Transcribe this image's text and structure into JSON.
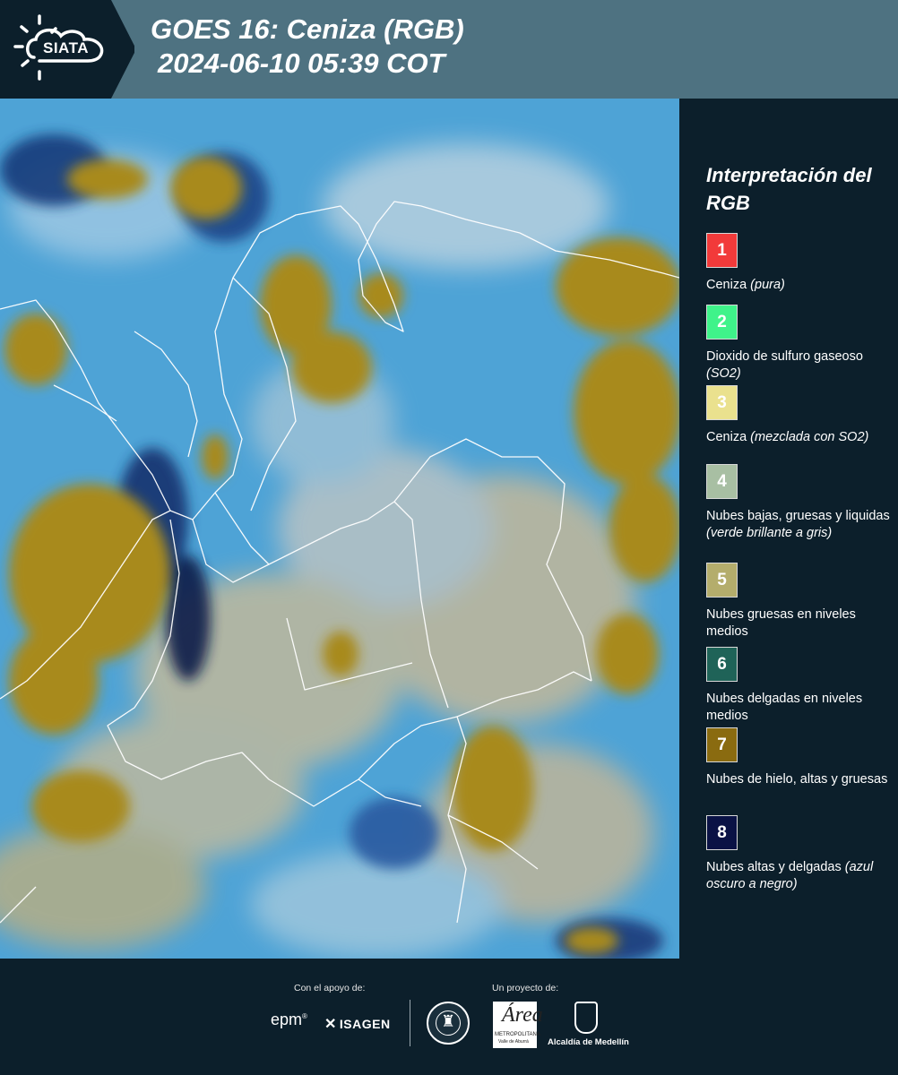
{
  "header": {
    "logo_text": "SIATA",
    "title_line1": "GOES 16: Ceniza (RGB)",
    "title_line2": "2024-06-10 05:39 COT"
  },
  "legend": {
    "title": "Interpretación del RGB",
    "items": [
      {
        "number": "1",
        "color": "#f23a3a",
        "text_color": "#ffffff",
        "label": "Ceniza",
        "note": "(pura)"
      },
      {
        "number": "2",
        "color": "#3ff38a",
        "text_color": "#ffffff",
        "label": "Dioxido de sulfuro gaseoso",
        "note": "(SO2)"
      },
      {
        "number": "3",
        "color": "#eae18e",
        "text_color": "#ffffff",
        "label": "Ceniza",
        "note": "(mezclada con SO2)"
      },
      {
        "number": "4",
        "color": "#a8bfa3",
        "text_color": "#ffffff",
        "label": "Nubes bajas, gruesas y liquidas",
        "note": "(verde brillante a gris)"
      },
      {
        "number": "5",
        "color": "#b4ad6c",
        "text_color": "#ffffff",
        "label": "Nubes gruesas en niveles medios",
        "note": ""
      },
      {
        "number": "6",
        "color": "#1f6358",
        "text_color": "#ffffff",
        "label": "Nubes delgadas en niveles medios",
        "note": ""
      },
      {
        "number": "7",
        "color": "#8a6b10",
        "text_color": "#ffffff",
        "label": "Nubes de hielo, altas y gruesas",
        "note": ""
      },
      {
        "number": "8",
        "color": "#0a1245",
        "text_color": "#ffffff",
        "label": "Nubes altas y delgadas",
        "note": "(azul oscuro a negro)"
      }
    ]
  },
  "footer": {
    "support_label": "Con el apoyo de:",
    "project_label": "Un proyecto de:",
    "sponsor1": "epm",
    "sponsor2": "ISAGEN",
    "partner_area_big": "Área",
    "partner_area_small1": "METROPOLITANA",
    "partner_area_small2": "Valle de Aburrá",
    "partner_medellin": "Alcaldía de Medellín"
  },
  "map": {
    "ocean_color": "#4ea3d6",
    "ice_cloud_color": "#a88a1e",
    "mid_cloud_color": "#c9b58a",
    "high_thin_color": "#10306a",
    "border_color": "#ffffff"
  }
}
